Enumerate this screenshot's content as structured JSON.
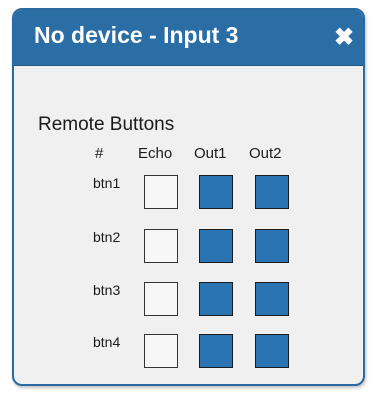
{
  "dialog": {
    "title": "No device - Input 3",
    "close_icon": "close-icon",
    "close_glyph": "✖"
  },
  "remote_buttons": {
    "heading": "Remote Buttons",
    "columns": [
      "#",
      "Echo",
      "Out1",
      "Out2"
    ],
    "rows": [
      {
        "label": "btn1",
        "echo": false,
        "out1": true,
        "out2": true
      },
      {
        "label": "btn2",
        "echo": false,
        "out1": true,
        "out2": true
      },
      {
        "label": "btn3",
        "echo": false,
        "out1": true,
        "out2": true
      },
      {
        "label": "btn4",
        "echo": false,
        "out1": true,
        "out2": true
      }
    ]
  },
  "colors": {
    "titlebar": "#2b6ea6",
    "checked": "#2b74b3",
    "unchecked": "#f7f7f7"
  }
}
